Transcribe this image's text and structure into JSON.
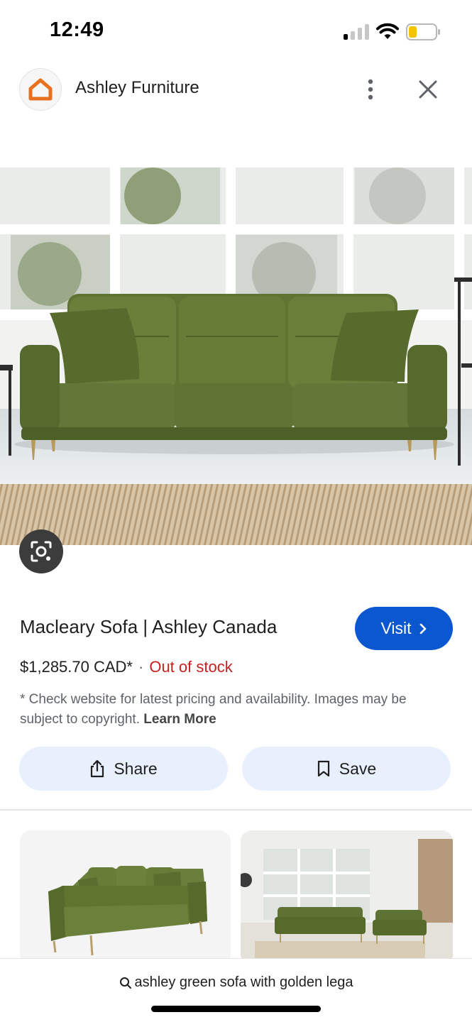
{
  "status": {
    "time": "12:49",
    "battery_level": 0.25,
    "signal_bars_active": 1
  },
  "header": {
    "site_name": "Ashley Furniture",
    "logo_icon": "house-icon",
    "logo_color": "#e8711f"
  },
  "hero": {
    "image_description_icon": "green-velvet-sofa-image"
  },
  "product": {
    "title": "Macleary Sofa | Ashley Canada",
    "visit_label": "Visit",
    "price": "$1,285.70 CAD*",
    "separator": "·",
    "stock_status": "Out of stock",
    "disclaimer": "* Check website for latest pricing and availability. Images may be subject to copyright.",
    "learn_more": "Learn More"
  },
  "actions": {
    "share_label": "Share",
    "save_label": "Save"
  },
  "search": {
    "query": "ashley green sofa with golden lega"
  },
  "colors": {
    "accent": "#0b57d0",
    "out_of_stock": "#c5221f",
    "action_bg": "#e8f0fe",
    "sofa_green": "#5e7232"
  }
}
